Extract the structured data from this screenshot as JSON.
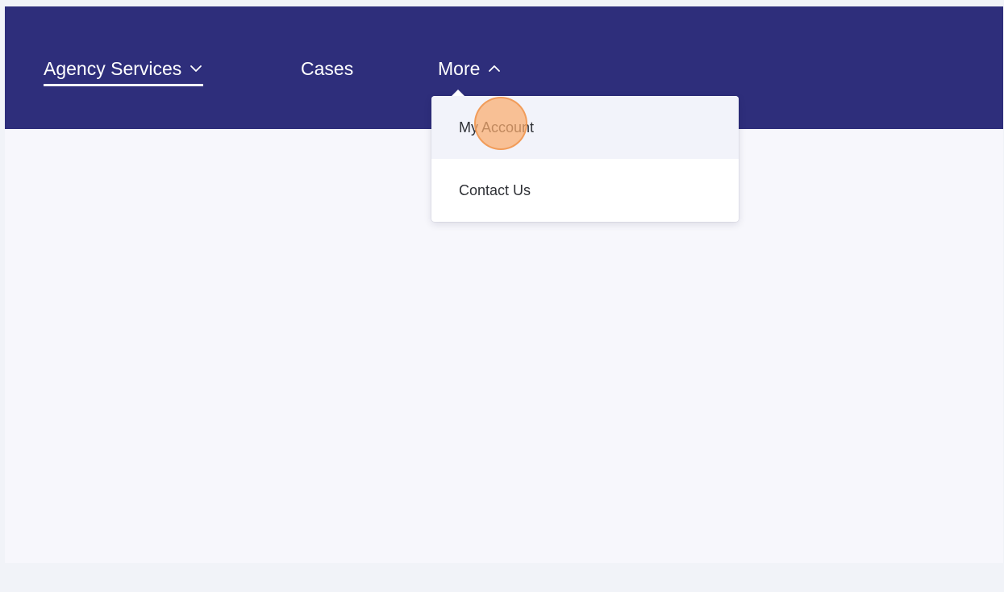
{
  "nav": {
    "items": [
      {
        "label": "Agency Services",
        "icon": "chevron-down-icon",
        "active": true
      },
      {
        "label": "Cases"
      },
      {
        "label": "More",
        "icon": "chevron-up-icon",
        "expanded": true
      }
    ]
  },
  "more_menu": {
    "items": [
      {
        "label": "My Account",
        "hovered": true
      },
      {
        "label": "Contact Us"
      }
    ]
  },
  "colors": {
    "nav_background": "#2e2e7b",
    "content_background": "#f7f7fc",
    "page_background": "#f1f3f8",
    "click_marker": "#faac6e"
  }
}
